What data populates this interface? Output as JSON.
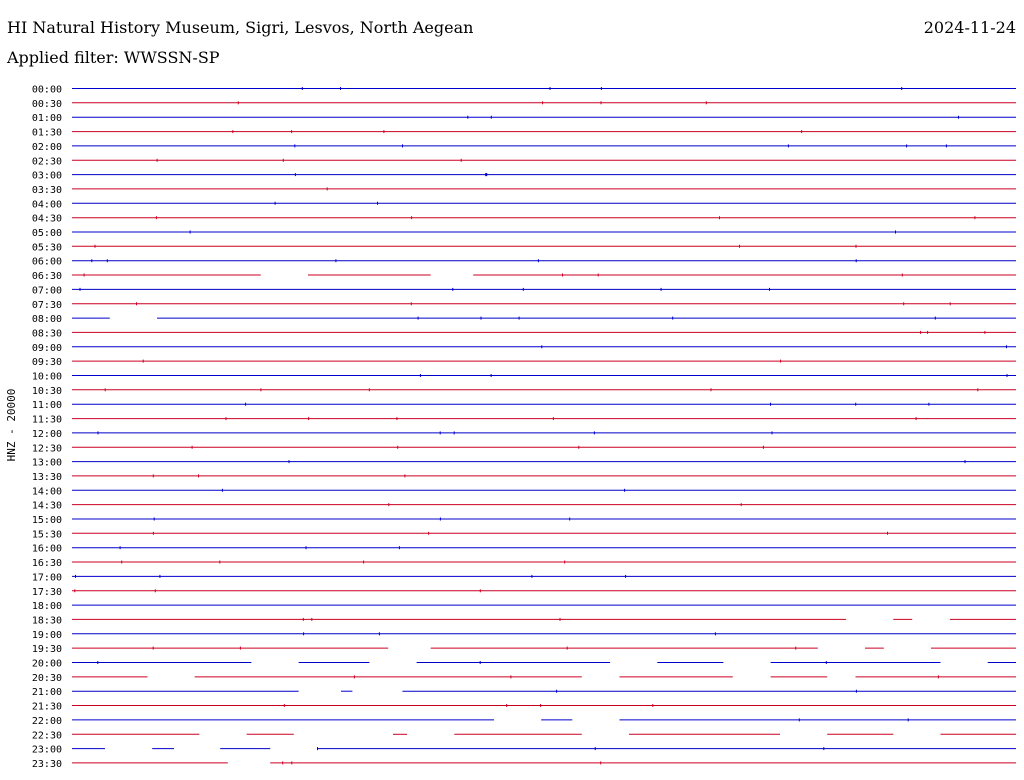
{
  "header": {
    "title": "HI Natural History Museum, Sigri, Lesvos, North Aegean",
    "date": "2024-11-24",
    "filter": "Applied filter: WWSSN-SP"
  },
  "chart_data": {
    "type": "line",
    "title": "HI Natural History Museum, Sigri, Lesvos, North Aegean",
    "ylabel": "HNZ - 20000",
    "colors": {
      "even_hour": "#0000cc",
      "half_hour": "#cc0022"
    },
    "rows": [
      {
        "label": "00:00",
        "gaps": []
      },
      {
        "label": "00:30",
        "gaps": []
      },
      {
        "label": "01:00",
        "gaps": []
      },
      {
        "label": "01:30",
        "gaps": []
      },
      {
        "label": "02:00",
        "gaps": []
      },
      {
        "label": "02:30",
        "gaps": []
      },
      {
        "label": "03:00",
        "gaps": []
      },
      {
        "label": "03:30",
        "gaps": []
      },
      {
        "label": "04:00",
        "gaps": []
      },
      {
        "label": "04:30",
        "gaps": []
      },
      {
        "label": "05:00",
        "gaps": []
      },
      {
        "label": "05:30",
        "gaps": []
      },
      {
        "label": "06:00",
        "gaps": []
      },
      {
        "label": "06:30",
        "gaps": [
          [
            0.2,
            0.25
          ],
          [
            0.38,
            0.425
          ]
        ]
      },
      {
        "label": "07:00",
        "gaps": []
      },
      {
        "label": "07:30",
        "gaps": []
      },
      {
        "label": "08:00",
        "gaps": [
          [
            0.04,
            0.09
          ]
        ]
      },
      {
        "label": "08:30",
        "gaps": []
      },
      {
        "label": "09:00",
        "gaps": []
      },
      {
        "label": "09:30",
        "gaps": []
      },
      {
        "label": "10:00",
        "gaps": []
      },
      {
        "label": "10:30",
        "gaps": []
      },
      {
        "label": "11:00",
        "gaps": []
      },
      {
        "label": "11:30",
        "gaps": []
      },
      {
        "label": "12:00",
        "gaps": []
      },
      {
        "label": "12:30",
        "gaps": []
      },
      {
        "label": "13:00",
        "gaps": []
      },
      {
        "label": "13:30",
        "gaps": []
      },
      {
        "label": "14:00",
        "gaps": []
      },
      {
        "label": "14:30",
        "gaps": []
      },
      {
        "label": "15:00",
        "gaps": []
      },
      {
        "label": "15:30",
        "gaps": []
      },
      {
        "label": "16:00",
        "gaps": []
      },
      {
        "label": "16:30",
        "gaps": []
      },
      {
        "label": "17:00",
        "gaps": []
      },
      {
        "label": "17:30",
        "gaps": []
      },
      {
        "label": "18:00",
        "gaps": []
      },
      {
        "label": "18:30",
        "gaps": [
          [
            0.82,
            0.87
          ],
          [
            0.89,
            0.93
          ]
        ]
      },
      {
        "label": "19:00",
        "gaps": []
      },
      {
        "label": "19:30",
        "gaps": [
          [
            0.335,
            0.38
          ],
          [
            0.79,
            0.84
          ],
          [
            0.86,
            0.91
          ]
        ]
      },
      {
        "label": "20:00",
        "gaps": [
          [
            0.19,
            0.24
          ],
          [
            0.315,
            0.365
          ],
          [
            0.57,
            0.62
          ],
          [
            0.69,
            0.74
          ],
          [
            0.92,
            0.97
          ]
        ]
      },
      {
        "label": "20:30",
        "gaps": [
          [
            0.08,
            0.13
          ],
          [
            0.54,
            0.58
          ],
          [
            0.7,
            0.74
          ],
          [
            0.8,
            0.83
          ]
        ]
      },
      {
        "label": "21:00",
        "gaps": [
          [
            0.24,
            0.285
          ],
          [
            0.297,
            0.35
          ]
        ]
      },
      {
        "label": "21:30",
        "gaps": []
      },
      {
        "label": "22:00",
        "gaps": [
          [
            0.447,
            0.497
          ],
          [
            0.53,
            0.58
          ]
        ]
      },
      {
        "label": "22:30",
        "gaps": [
          [
            0.135,
            0.185
          ],
          [
            0.235,
            0.34
          ],
          [
            0.355,
            0.405
          ],
          [
            0.54,
            0.59
          ],
          [
            0.75,
            0.8
          ],
          [
            0.87,
            0.92
          ]
        ]
      },
      {
        "label": "23:00",
        "gaps": [
          [
            0.035,
            0.085
          ],
          [
            0.108,
            0.157
          ],
          [
            0.21,
            0.26
          ]
        ]
      },
      {
        "label": "23:30",
        "gaps": [
          [
            0.165,
            0.21
          ]
        ]
      }
    ]
  }
}
